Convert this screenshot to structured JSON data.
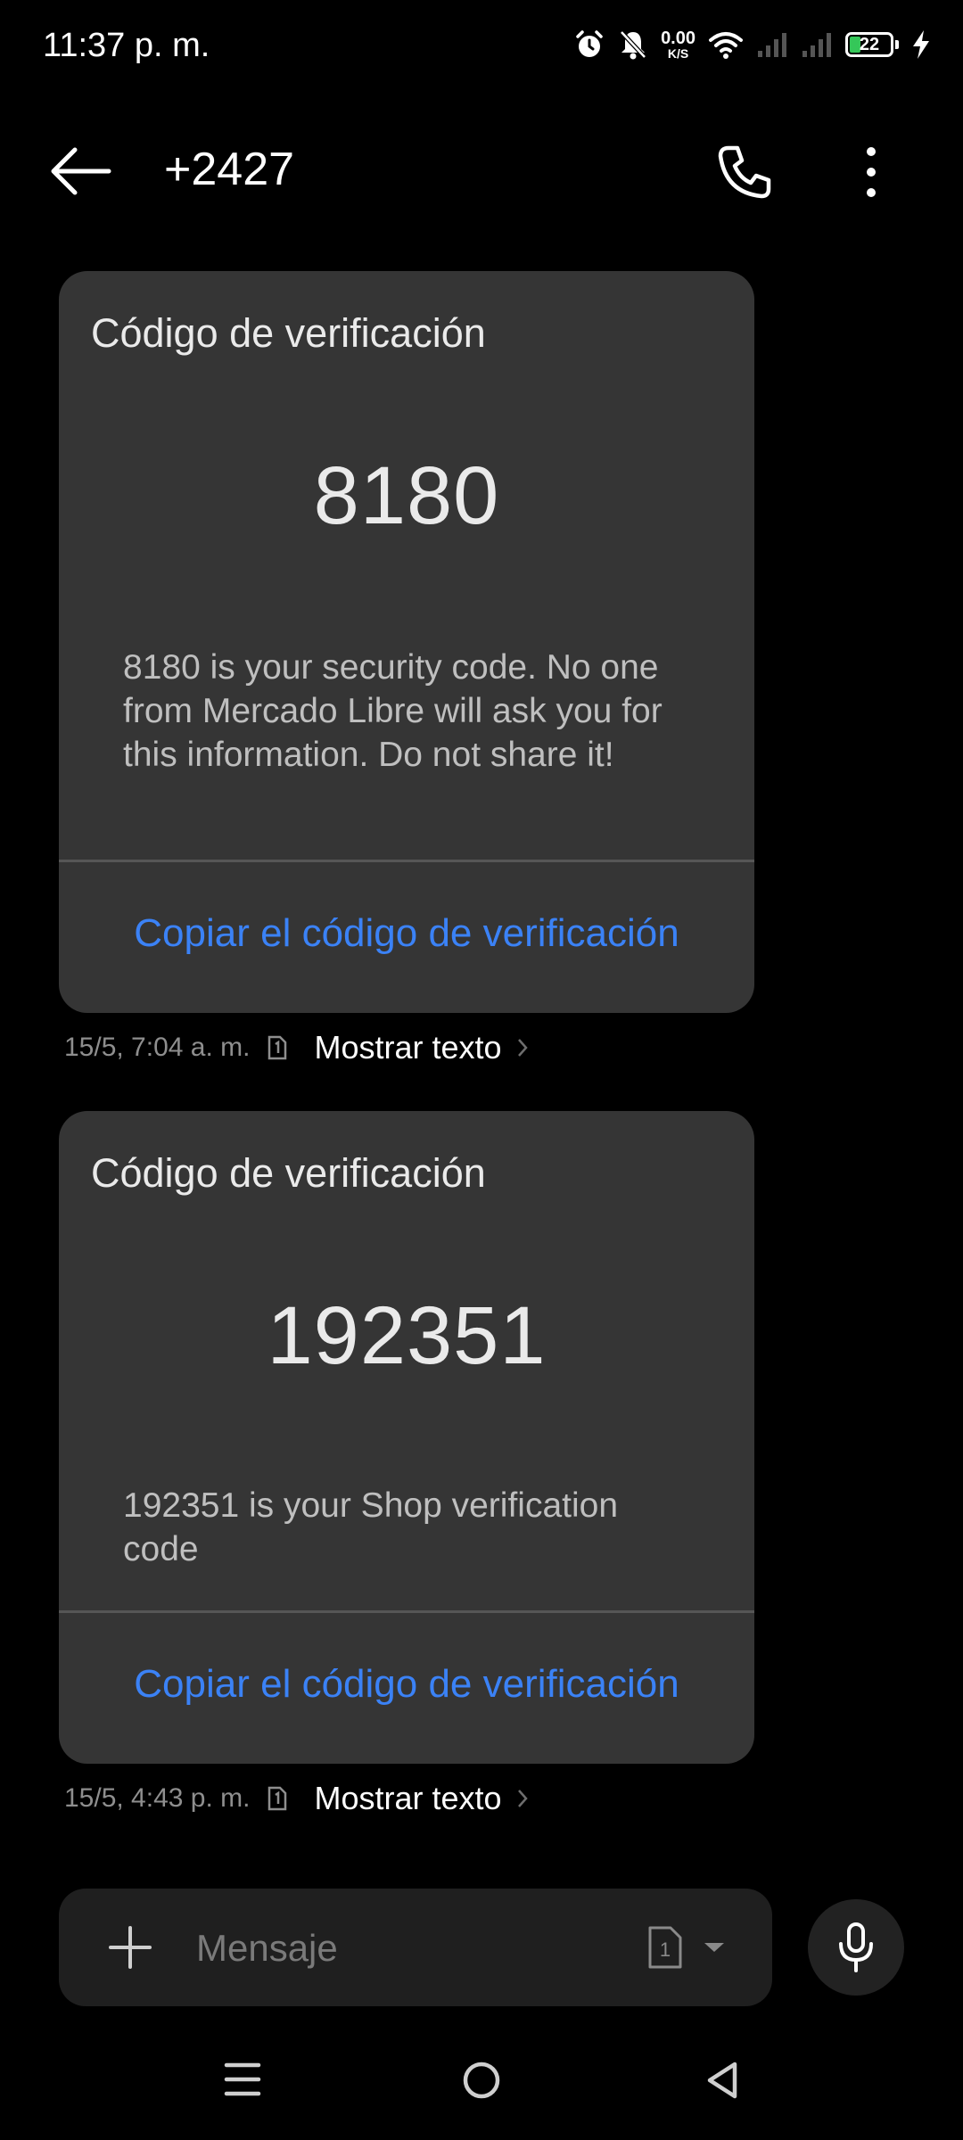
{
  "status_bar": {
    "time": "11:37 p. m.",
    "speed_value": "0.00",
    "speed_unit": "K/S",
    "battery": "22",
    "icons": [
      "alarm-icon",
      "bell-off-icon",
      "wifi-icon",
      "signal-icon",
      "signal-icon",
      "battery-icon",
      "charging-icon"
    ]
  },
  "header": {
    "title": "+2427",
    "icons": [
      "back-arrow-icon",
      "phone-icon",
      "more-vertical-icon"
    ]
  },
  "messages": [
    {
      "card_title": "Código de verificación",
      "code": "8180",
      "body": "8180 is your security code. No one from Mercado Libre will ask you for this information. Do not share it!",
      "copy_label": "Copiar el código de verificación",
      "time": "15/5, 7:04 a. m.",
      "show_text": "Mostrar texto"
    },
    {
      "card_title": "Código de verificación",
      "code": "192351",
      "body": "192351 is your Shop verification code",
      "copy_label": "Copiar el código de verificación",
      "time": "15/5, 4:43 p. m.",
      "show_text": "Mostrar texto"
    }
  ],
  "compose": {
    "placeholder": "Mensaje",
    "sim": "1"
  },
  "colors": {
    "background": "#000000",
    "card": "#353535",
    "accent": "#3b82f6",
    "battery_fill": "#35c759"
  }
}
